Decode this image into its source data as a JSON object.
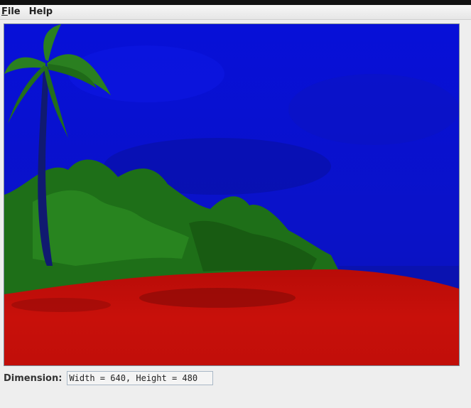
{
  "menubar": {
    "items": [
      {
        "label_mnemonic": "F",
        "label_rest": "ile"
      },
      {
        "label_mnemonic": "",
        "label_rest": "Help"
      }
    ]
  },
  "image": {
    "description_icon": "processed-beach-image",
    "colors": {
      "sky": "#0a10d4",
      "foliage": "#1f7a1a",
      "sand": "#c40d0a"
    }
  },
  "dimension": {
    "label": "Dimension:",
    "value": "Width = 640, Height = 480"
  }
}
